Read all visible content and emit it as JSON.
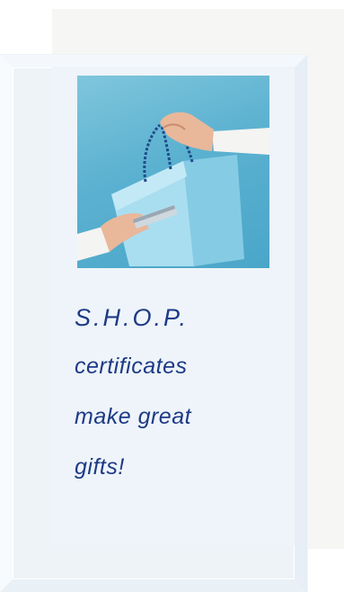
{
  "promo": {
    "line1": "S.H.O.P.",
    "line2": "certificates",
    "line3": "make great",
    "line4": "gifts!"
  },
  "image": {
    "icon": "shopping-bag-gift-photo"
  },
  "colors": {
    "text": "#1d3a86",
    "card": "#eef3f8",
    "photo_bg": "#5bb1d0",
    "bag": "#9fd8ee"
  }
}
